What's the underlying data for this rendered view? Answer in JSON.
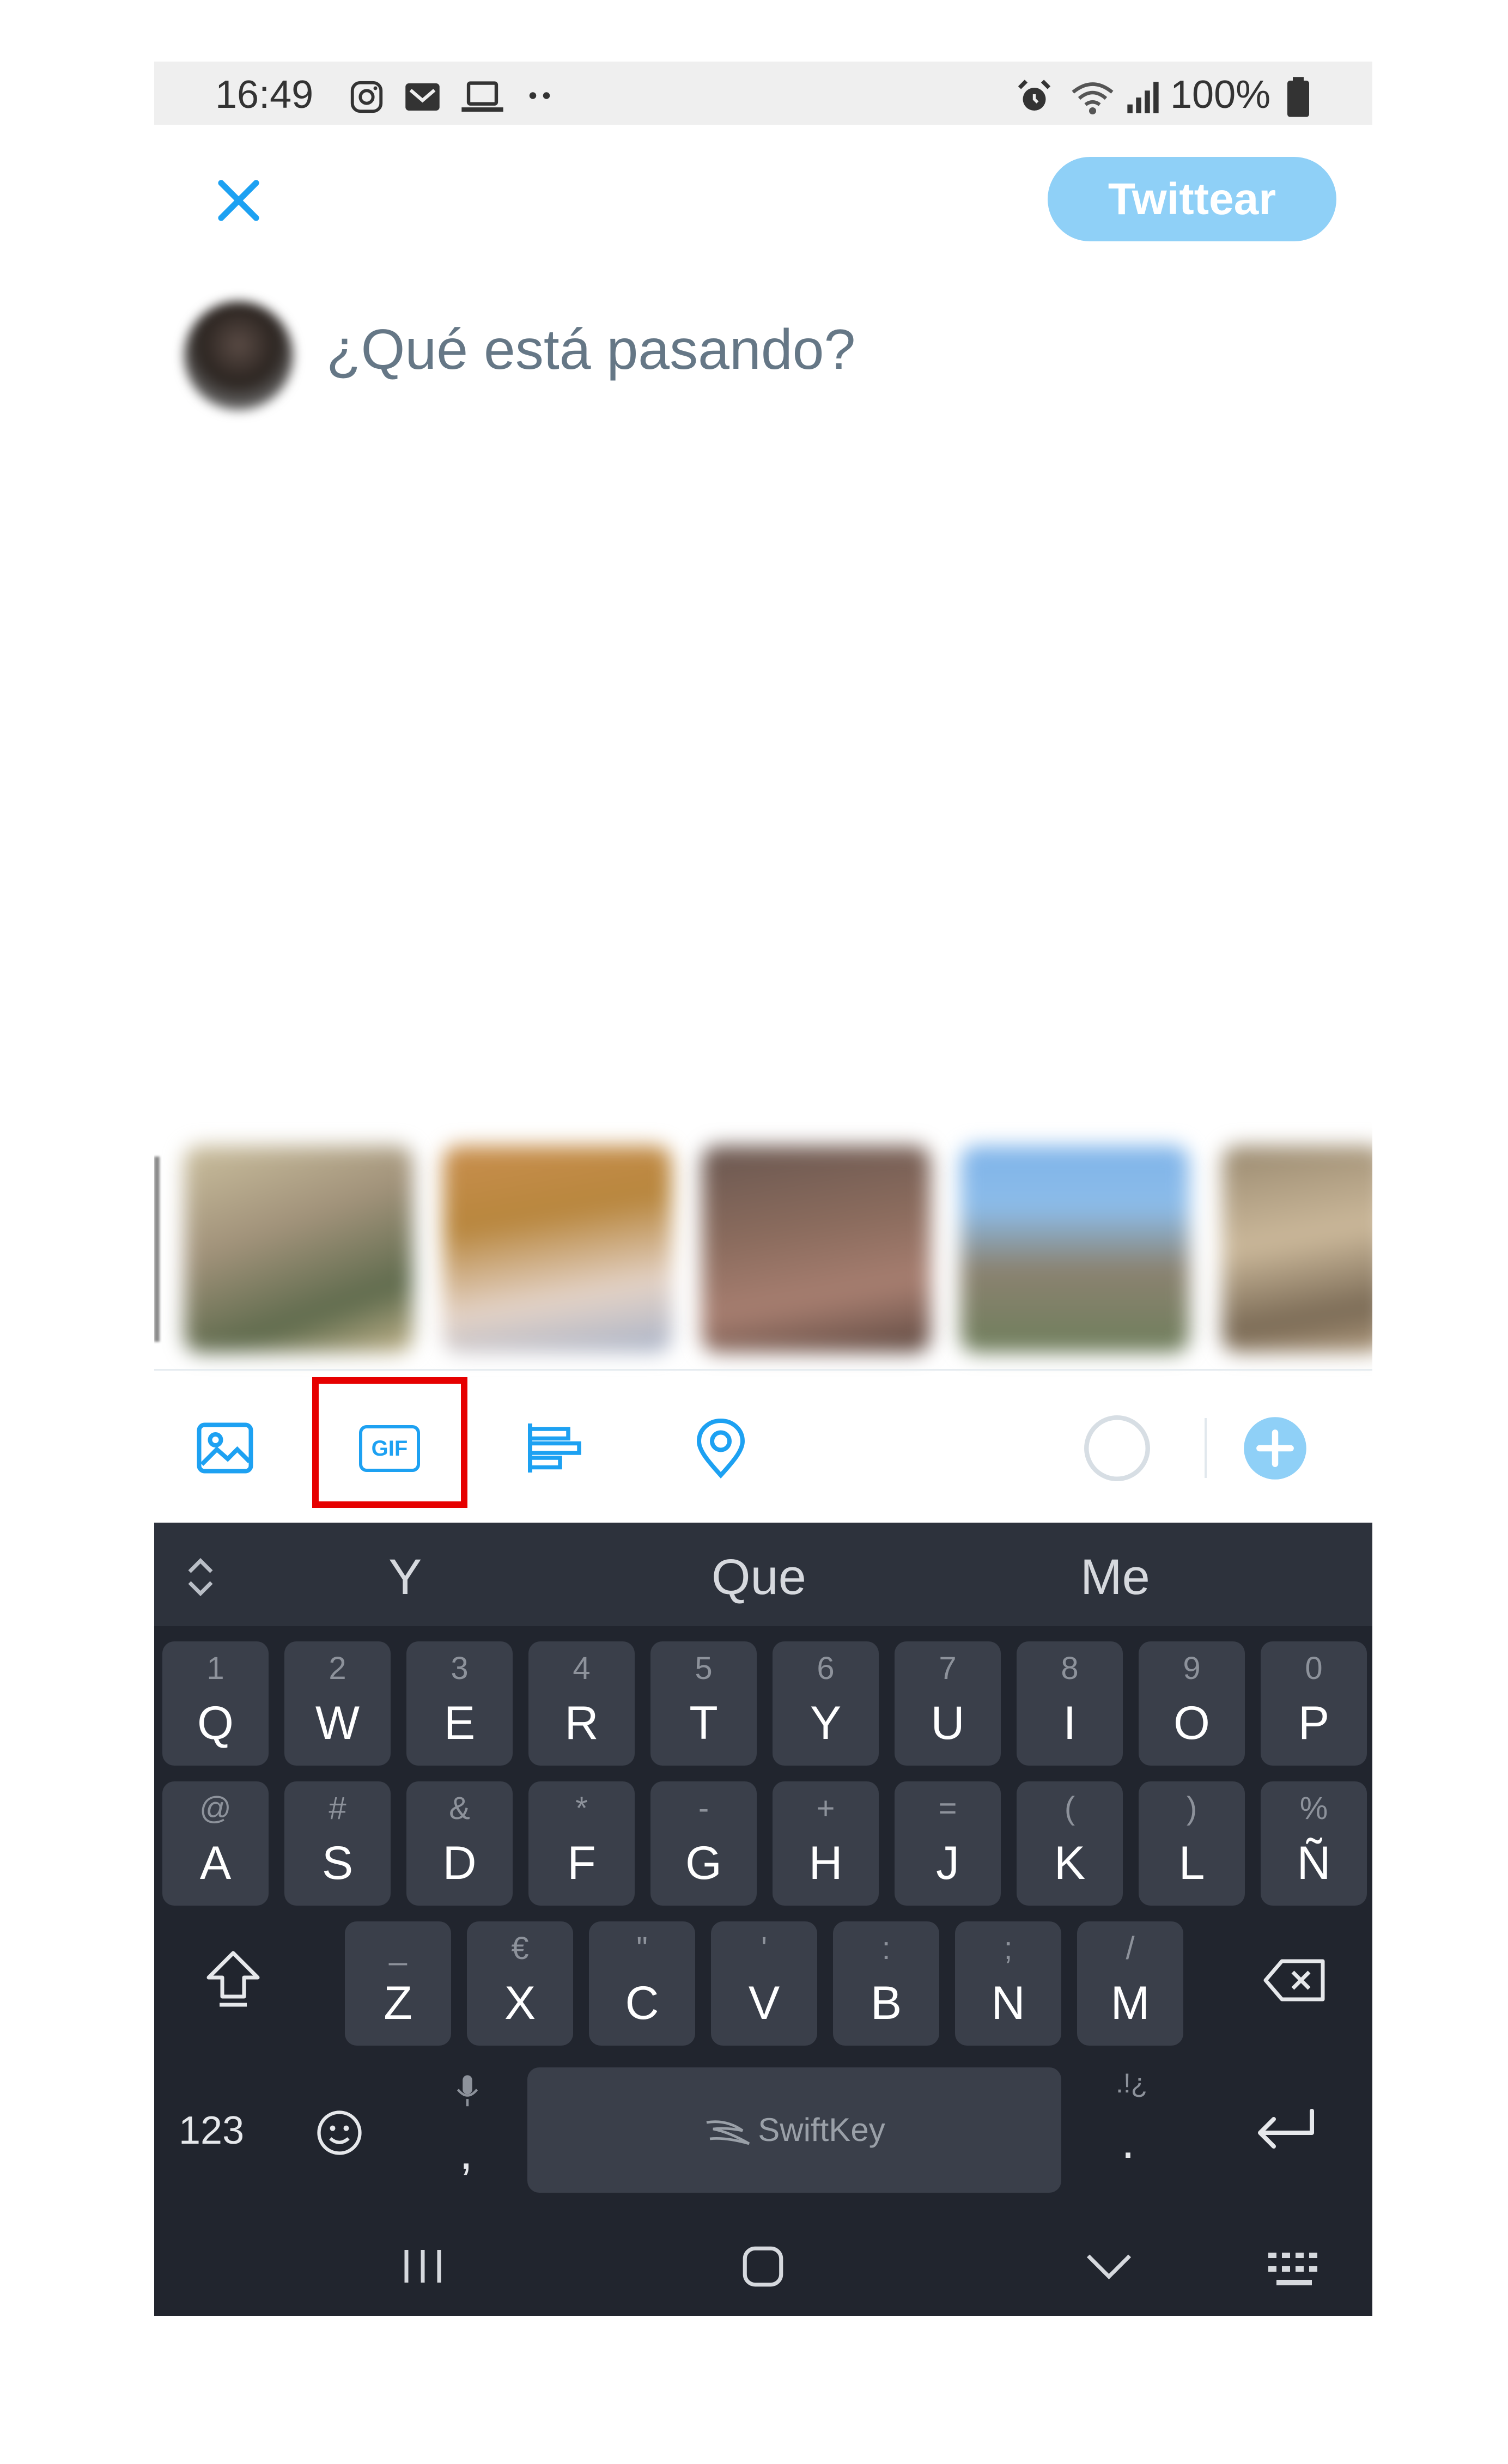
{
  "status_bar": {
    "time": "16:49",
    "battery": "100%",
    "left_icons": [
      "instagram-icon",
      "gmail-icon",
      "laptop-icon",
      "more-dots-icon"
    ],
    "right_icons": [
      "alarm-icon",
      "wifi-icon",
      "signal-icon",
      "battery-icon"
    ]
  },
  "compose": {
    "close_icon": "close-icon",
    "tweet_button": "Twittear",
    "placeholder": "¿Qué está pasando?"
  },
  "toolbar": {
    "gif_label": "GIF",
    "icons": [
      "image-icon",
      "gif-icon",
      "poll-icon",
      "location-icon",
      "char-count-circle",
      "add-tweet-icon"
    ],
    "highlighted": "gif-icon"
  },
  "keyboard": {
    "suggestions": [
      "Y",
      "Que",
      "Me"
    ],
    "row1": [
      {
        "main": "Q",
        "alt": "1"
      },
      {
        "main": "W",
        "alt": "2"
      },
      {
        "main": "E",
        "alt": "3"
      },
      {
        "main": "R",
        "alt": "4"
      },
      {
        "main": "T",
        "alt": "5"
      },
      {
        "main": "Y",
        "alt": "6"
      },
      {
        "main": "U",
        "alt": "7"
      },
      {
        "main": "I",
        "alt": "8"
      },
      {
        "main": "O",
        "alt": "9"
      },
      {
        "main": "P",
        "alt": "0"
      }
    ],
    "row2": [
      {
        "main": "A",
        "alt": "@"
      },
      {
        "main": "S",
        "alt": "#"
      },
      {
        "main": "D",
        "alt": "&"
      },
      {
        "main": "F",
        "alt": "*"
      },
      {
        "main": "G",
        "alt": "-"
      },
      {
        "main": "H",
        "alt": "+"
      },
      {
        "main": "J",
        "alt": "="
      },
      {
        "main": "K",
        "alt": "("
      },
      {
        "main": "L",
        "alt": ")"
      },
      {
        "main": "Ñ",
        "alt": "%"
      }
    ],
    "row3": [
      {
        "main": "Z",
        "alt": "_"
      },
      {
        "main": "X",
        "alt": "€"
      },
      {
        "main": "C",
        "alt": "\""
      },
      {
        "main": "V",
        "alt": "'"
      },
      {
        "main": "B",
        "alt": ":"
      },
      {
        "main": "N",
        "alt": ";"
      },
      {
        "main": "M",
        "alt": "/"
      }
    ],
    "numbers_key": "123",
    "comma_key": ",",
    "period_key": ".",
    "period_alt": ".!¿",
    "space_label": "SwiftKey"
  }
}
